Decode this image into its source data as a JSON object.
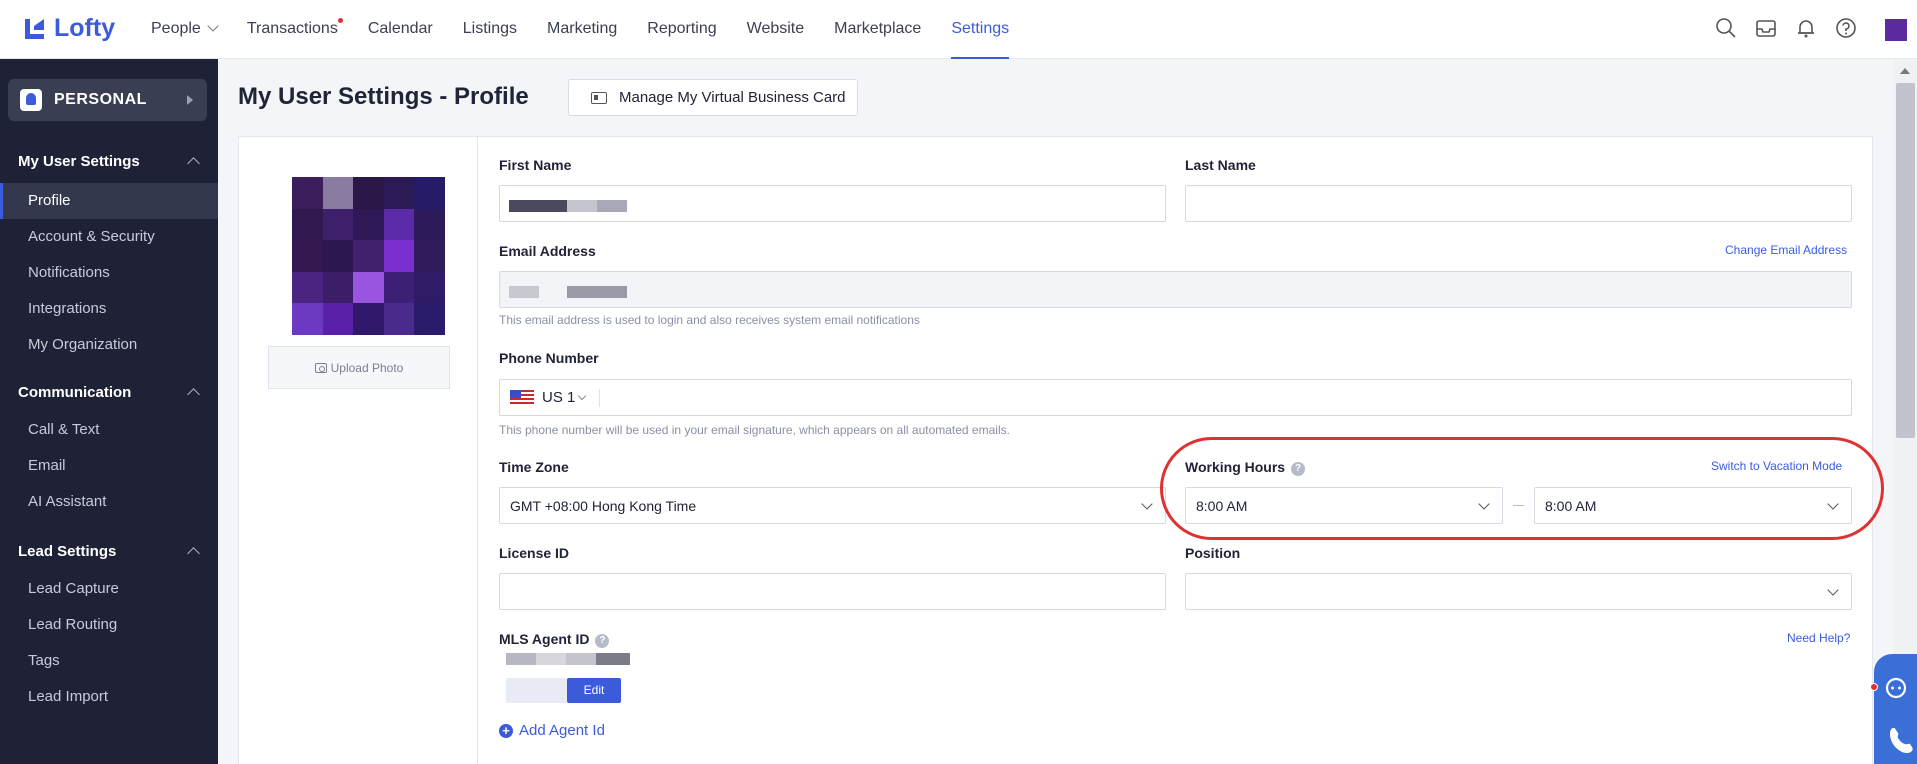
{
  "brand": {
    "name": "Lofty",
    "accent": "#3b5bdb",
    "sidebar_bg": "#1f2236",
    "highlight": "#e03131"
  },
  "nav": {
    "items": [
      {
        "label": "People",
        "dropdown": true
      },
      {
        "label": "Transactions",
        "badge": true
      },
      {
        "label": "Calendar"
      },
      {
        "label": "Listings"
      },
      {
        "label": "Marketing"
      },
      {
        "label": "Reporting"
      },
      {
        "label": "Website"
      },
      {
        "label": "Marketplace"
      },
      {
        "label": "Settings",
        "active": true
      }
    ],
    "icons": [
      "search-icon",
      "inbox-icon",
      "bell-icon",
      "help-icon"
    ]
  },
  "sidebar": {
    "personal_label": "PERSONAL",
    "sections": [
      {
        "title": "My User Settings",
        "items": [
          "Profile",
          "Account & Security",
          "Notifications",
          "Integrations",
          "My Organization"
        ]
      },
      {
        "title": "Communication",
        "items": [
          "Call & Text",
          "Email",
          "AI Assistant"
        ]
      },
      {
        "title": "Lead Settings",
        "items": [
          "Lead Capture",
          "Lead Routing",
          "Tags",
          "Lead Import"
        ]
      }
    ],
    "active_item": "Profile"
  },
  "page": {
    "title": "My User Settings - Profile",
    "vcard_button": "Manage My Virtual Business Card",
    "upload_photo": "Upload Photo"
  },
  "form": {
    "first_name_label": "First Name",
    "last_name_label": "Last Name",
    "email_label": "Email Address",
    "change_email_link": "Change Email Address",
    "email_help": "This email address is used to login and also receives system email notifications",
    "phone_label": "Phone Number",
    "phone_country": "US 1",
    "phone_help": "This phone number will be used in your email signature, which appears on all automated emails.",
    "timezone_label": "Time Zone",
    "timezone_value": "GMT +08:00 Hong Kong Time",
    "working_hours_label": "Working Hours",
    "vacation_link": "Switch to Vacation Mode",
    "start_time": "8:00 AM",
    "end_time": "8:00 AM",
    "license_label": "License ID",
    "position_label": "Position",
    "mls_label": "MLS Agent ID",
    "need_help_link": "Need Help?",
    "edit_button": "Edit",
    "add_agent_link": "Add Agent Id"
  }
}
